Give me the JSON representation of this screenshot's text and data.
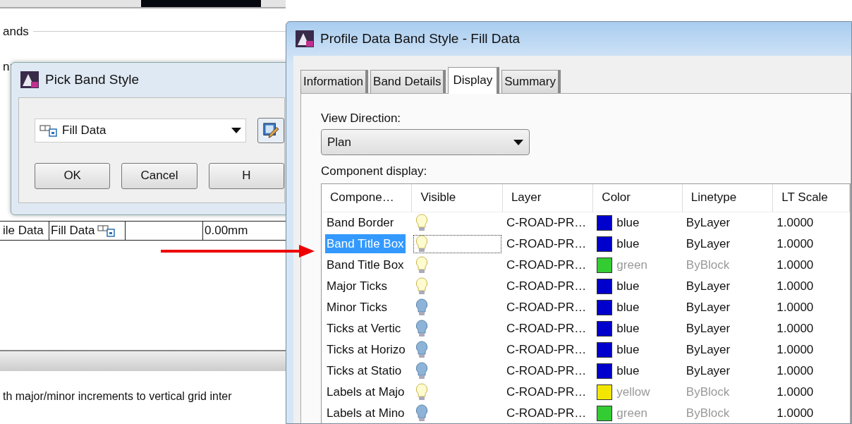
{
  "background_window": {
    "group_label": "ands",
    "field_label": "n:",
    "table_row": [
      "ile Data",
      "Fill Data",
      "0.00mm"
    ],
    "description": "th major/minor increments to vertical grid inter"
  },
  "pick_dialog": {
    "title": "Pick Band Style",
    "style_select": "Fill Data",
    "buttons": [
      "OK",
      "Cancel",
      "H"
    ]
  },
  "style_dialog": {
    "title": "Profile Data Band Style - Fill Data",
    "tabs": [
      {
        "label": "Information",
        "selected": false
      },
      {
        "label": "Band Details",
        "selected": false
      },
      {
        "label": "Display",
        "selected": true
      },
      {
        "label": "Summary",
        "selected": false
      }
    ],
    "view_direction_label": "View Direction:",
    "view_direction": "Plan",
    "component_label": "Component display:",
    "columns": [
      "Compone…",
      "Visible",
      "Layer",
      "Color",
      "Linetype",
      "LT Scale"
    ],
    "rows": [
      {
        "component": "Band Border",
        "visible": true,
        "layer": "C-ROAD-PR…",
        "color": "#0000cc",
        "color_name": "blue",
        "linetype": "ByLayer",
        "lt_scale": "1.0000",
        "selected": false,
        "greyed": false
      },
      {
        "component": "Band Title Box",
        "visible": true,
        "layer": "C-ROAD-PR…",
        "color": "#0000cc",
        "color_name": "blue",
        "linetype": "ByLayer",
        "lt_scale": "1.0000",
        "selected": true,
        "greyed": false
      },
      {
        "component": "Band Title Box",
        "visible": true,
        "layer": "C-ROAD-PR…",
        "color": "#33cc33",
        "color_name": "green",
        "linetype": "ByBlock",
        "lt_scale": "1.0000",
        "selected": false,
        "greyed": true
      },
      {
        "component": "Major Ticks",
        "visible": true,
        "layer": "C-ROAD-PR…",
        "color": "#0000cc",
        "color_name": "blue",
        "linetype": "ByLayer",
        "lt_scale": "1.0000",
        "selected": false,
        "greyed": false
      },
      {
        "component": "Minor Ticks",
        "visible": false,
        "layer": "C-ROAD-PR…",
        "color": "#0000cc",
        "color_name": "blue",
        "linetype": "ByLayer",
        "lt_scale": "1.0000",
        "selected": false,
        "greyed": false
      },
      {
        "component": "Ticks at Vertic",
        "visible": false,
        "layer": "C-ROAD-PR…",
        "color": "#0000cc",
        "color_name": "blue",
        "linetype": "ByLayer",
        "lt_scale": "1.0000",
        "selected": false,
        "greyed": false
      },
      {
        "component": "Ticks at Horizo",
        "visible": false,
        "layer": "C-ROAD-PR…",
        "color": "#0000cc",
        "color_name": "blue",
        "linetype": "ByLayer",
        "lt_scale": "1.0000",
        "selected": false,
        "greyed": false
      },
      {
        "component": "Ticks at Statio",
        "visible": false,
        "layer": "C-ROAD-PR…",
        "color": "#0000cc",
        "color_name": "blue",
        "linetype": "ByLayer",
        "lt_scale": "1.0000",
        "selected": false,
        "greyed": false
      },
      {
        "component": "Labels at Majo",
        "visible": true,
        "layer": "C-ROAD-PR…",
        "color": "#f2e600",
        "color_name": "yellow",
        "linetype": "ByBlock",
        "lt_scale": "1.0000",
        "selected": false,
        "greyed": true
      },
      {
        "component": "Labels at Mino",
        "visible": false,
        "layer": "C-ROAD-PR…",
        "color": "#33cc33",
        "color_name": "green",
        "linetype": "ByBlock",
        "lt_scale": "1.0000",
        "selected": false,
        "greyed": true
      }
    ]
  }
}
